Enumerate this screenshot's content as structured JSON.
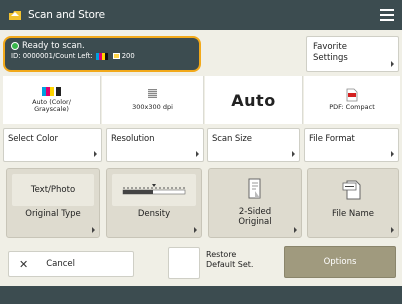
{
  "title": "Scan and Store",
  "status": {
    "ready": "Ready to scan.",
    "detail_prefix": "ID: 0000001/Count Left:",
    "detail_count": "200"
  },
  "favorite_settings": {
    "line1": "Favorite",
    "line2": "Settings"
  },
  "current_settings": {
    "color": {
      "line1": "Auto (Color/",
      "line2": "Grayscale)"
    },
    "resolution": "300x300 dpi",
    "scan_size": "Auto",
    "file_format": "PDF: Compact"
  },
  "setting_buttons": {
    "select_color": "Select Color",
    "resolution": "Resolution",
    "scan_size": "Scan Size",
    "file_format": "File Format"
  },
  "big_buttons": {
    "original_type_preview": "Text/Photo",
    "original_type": "Original Type",
    "density": "Density",
    "two_sided_line1": "2-Sided",
    "two_sided_line2": "Original",
    "file_name": "File Name"
  },
  "bottom": {
    "cancel": "Cancel",
    "restore_line1": "Restore",
    "restore_line2": "Default Set.",
    "options": "Options"
  },
  "colors": {
    "titlebar": "#3c4c50",
    "status_highlight": "#f2a91a",
    "ready_indicator": "#39b54a",
    "options_button": "#a09a7e",
    "background": "#f0efe6"
  },
  "icons": {
    "app": "folder-scan-icon",
    "menu": "menu-icon",
    "color": "color-toner-icon",
    "resolution": "resolution-icon",
    "file_format": "pdf-file-icon",
    "density": "density-scale-icon",
    "two_sided": "two-sided-page-icon",
    "file_name": "file-name-icon",
    "cancel": "close-icon"
  }
}
